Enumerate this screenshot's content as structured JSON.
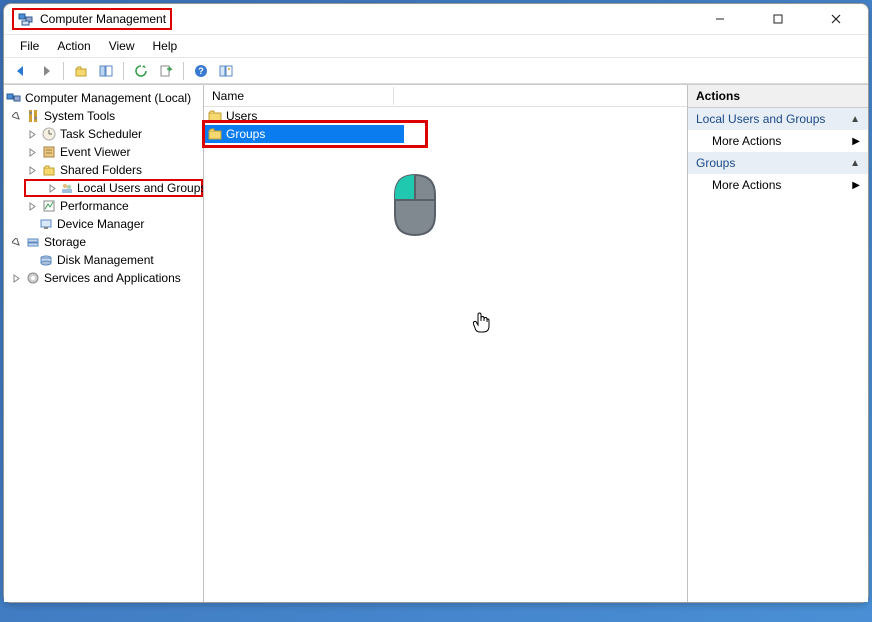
{
  "window": {
    "title": "Computer Management"
  },
  "menu": {
    "file": "File",
    "action": "Action",
    "view": "View",
    "help": "Help"
  },
  "tree": {
    "root": "Computer Management (Local)",
    "system_tools": "System Tools",
    "task_scheduler": "Task Scheduler",
    "event_viewer": "Event Viewer",
    "shared_folders": "Shared Folders",
    "local_users_groups": "Local Users and Groups",
    "performance": "Performance",
    "device_manager": "Device Manager",
    "storage": "Storage",
    "disk_management": "Disk Management",
    "services_apps": "Services and Applications"
  },
  "list": {
    "column_name": "Name",
    "item_users": "Users",
    "item_groups": "Groups"
  },
  "actions": {
    "header": "Actions",
    "group1": "Local Users and Groups",
    "more1": "More Actions",
    "group2": "Groups",
    "more2": "More Actions"
  }
}
